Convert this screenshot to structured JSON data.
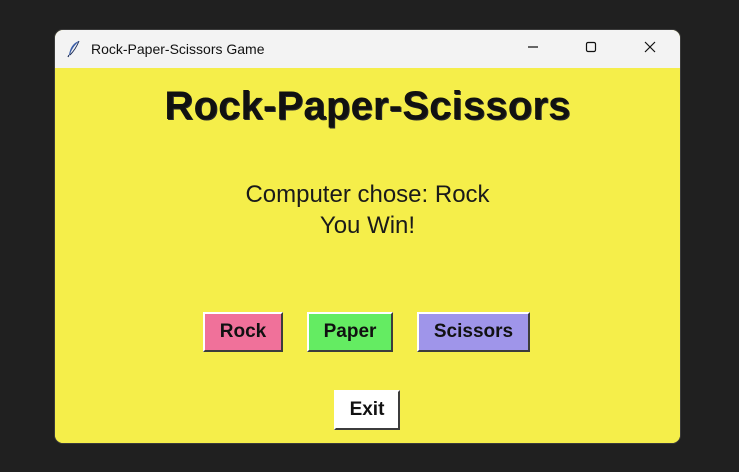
{
  "window": {
    "title": "Rock-Paper-Scissors Game",
    "background": "#f5ee4a"
  },
  "game": {
    "heading": "Rock-Paper-Scissors",
    "computer_choice_text": "Computer chose: Rock",
    "result_text": "You Win!"
  },
  "buttons": {
    "rock": {
      "label": "Rock",
      "color": "#f0719a"
    },
    "paper": {
      "label": "Paper",
      "color": "#64ec62"
    },
    "scissors": {
      "label": "Scissors",
      "color": "#9f95ea"
    },
    "exit": {
      "label": "Exit",
      "color": "#ffffff"
    }
  },
  "icons": {
    "app": "feather-icon",
    "minimize": "minimize-icon",
    "maximize": "maximize-icon",
    "close": "close-icon"
  }
}
